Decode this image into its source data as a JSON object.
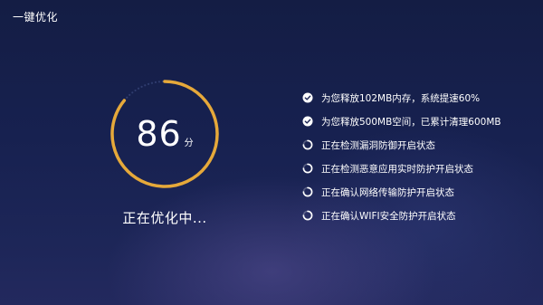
{
  "window": {
    "title": "一键优化"
  },
  "gauge": {
    "score": "86",
    "unit": "分",
    "progress_percent": 86,
    "colors": {
      "arc": "#e6a93a",
      "track_dots": "#2f3c6e"
    }
  },
  "status": {
    "text": "正在优化中..."
  },
  "tasks": [
    {
      "label": "为您释放102MB内存，系统提速60%",
      "state": "done",
      "icon": "check-circle-icon"
    },
    {
      "label": "为您释放500MB空间，已累计清理600MB",
      "state": "done",
      "icon": "check-circle-icon"
    },
    {
      "label": "正在检测漏洞防御开启状态",
      "state": "in-progress",
      "icon": "spinner-icon"
    },
    {
      "label": "正在检测恶意应用实时防护开启状态",
      "state": "in-progress",
      "icon": "spinner-icon"
    },
    {
      "label": "正在确认网络传输防护开启状态",
      "state": "in-progress",
      "icon": "spinner-icon"
    },
    {
      "label": "正在确认WIFI安全防护开启状态",
      "state": "in-progress",
      "icon": "spinner-icon"
    }
  ],
  "colors": {
    "background": "#172150",
    "text": "#ffffff",
    "accent": "#e6a93a"
  }
}
